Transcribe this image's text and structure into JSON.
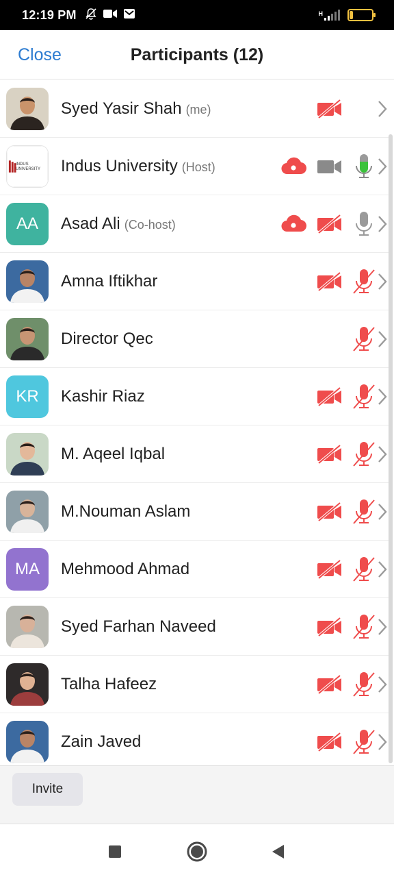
{
  "status_bar": {
    "time": "12:19 PM",
    "icons": [
      "bell-off-icon",
      "videocam-icon",
      "mail-icon"
    ],
    "network_label": "H",
    "battery_level": "17",
    "battery_fraction": 0.17
  },
  "header": {
    "close_label": "Close",
    "title": "Participants (12)"
  },
  "participants": [
    {
      "name": "Syed Yasir Shah",
      "role": "(me)",
      "avatar": "photo",
      "cloud": false,
      "video": "off",
      "mic": "none"
    },
    {
      "name": "Indus University",
      "role": "(Host)",
      "avatar": "logo",
      "logo_text": "INDUS UNIVERSITY",
      "cloud": true,
      "video": "on",
      "mic": "active"
    },
    {
      "name": "Asad Ali",
      "role": "(Co-host)",
      "avatar": "initials",
      "initials": "AA",
      "avatar_color": "#3fb39f",
      "cloud": true,
      "video": "off",
      "mic": "on"
    },
    {
      "name": "Amna Iftikhar",
      "role": "",
      "avatar": "photo",
      "cloud": false,
      "video": "off",
      "mic": "muted"
    },
    {
      "name": "Director Qec",
      "role": "",
      "avatar": "photo",
      "cloud": false,
      "video": "none",
      "mic": "muted"
    },
    {
      "name": "Kashir Riaz",
      "role": "",
      "avatar": "initials",
      "initials": "KR",
      "avatar_color": "#4fc7de",
      "cloud": false,
      "video": "off",
      "mic": "muted"
    },
    {
      "name": "M. Aqeel Iqbal",
      "role": "",
      "avatar": "photo",
      "cloud": false,
      "video": "off",
      "mic": "muted"
    },
    {
      "name": "M.Nouman Aslam",
      "role": "",
      "avatar": "photo",
      "cloud": false,
      "video": "off",
      "mic": "muted"
    },
    {
      "name": "Mehmood Ahmad",
      "role": "",
      "avatar": "initials",
      "initials": "MA",
      "avatar_color": "#9273cf",
      "cloud": false,
      "video": "off",
      "mic": "muted"
    },
    {
      "name": "Syed Farhan Naveed",
      "role": "",
      "avatar": "photo",
      "cloud": false,
      "video": "off",
      "mic": "muted"
    },
    {
      "name": "Talha Hafeez",
      "role": "",
      "avatar": "photo",
      "cloud": false,
      "video": "off",
      "mic": "muted"
    },
    {
      "name": "Zain Javed",
      "role": "",
      "avatar": "photo",
      "cloud": false,
      "video": "off",
      "mic": "muted"
    }
  ],
  "footer": {
    "invite_label": "Invite"
  },
  "nav_bar": {
    "buttons": [
      "recents-square-icon",
      "home-circle-icon",
      "back-triangle-icon"
    ]
  },
  "colors": {
    "accent_blue": "#2d7cd1",
    "alert_red": "#ef4c4c",
    "mic_active_green": "#3cc23c",
    "icon_gray": "#8a8a8a"
  }
}
